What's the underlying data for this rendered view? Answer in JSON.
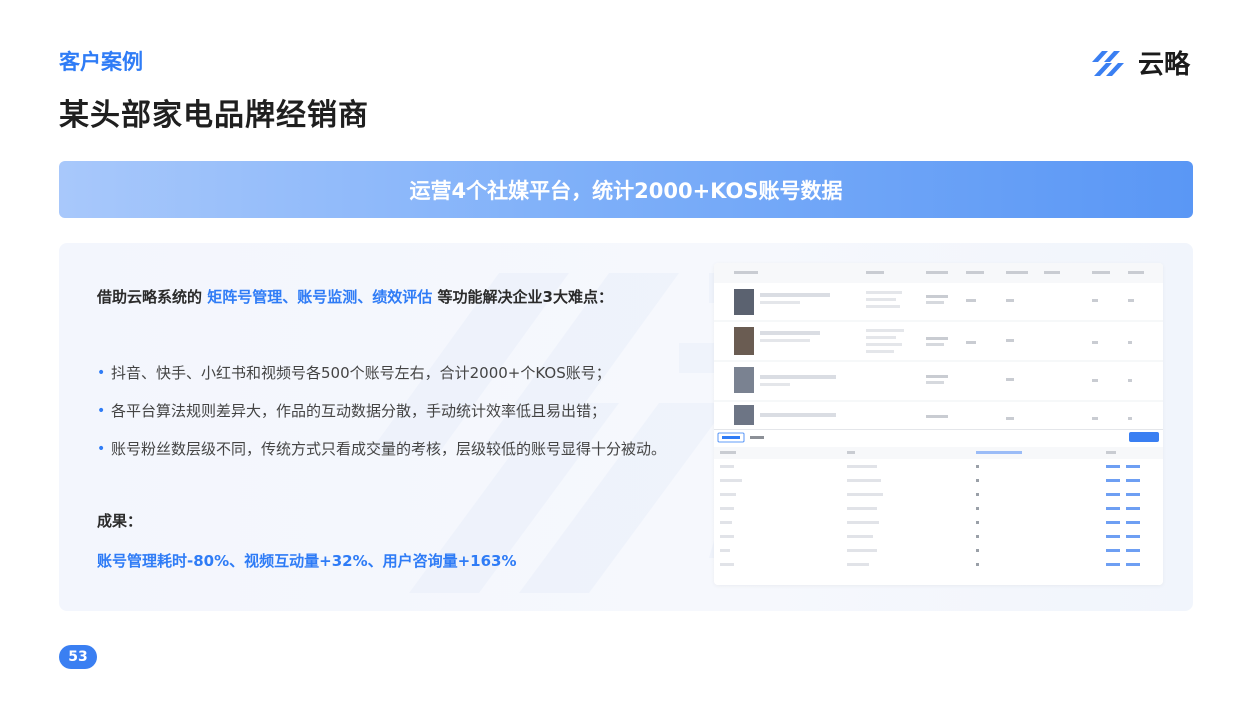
{
  "header": {
    "section_label": "客户案例",
    "title": "某头部家电品牌经销商"
  },
  "logo": {
    "text": "云略",
    "icon": "yunlue-logo-icon",
    "color": "#3a7ff2"
  },
  "banner": {
    "text": "运营4个社媒平台，统计2000+KOS账号数据"
  },
  "content": {
    "intro_prefix": "借助云略系统的",
    "intro_highlight": "矩阵号管理、账号监测、绩效评估",
    "intro_suffix": "等功能解决企业3大难点：",
    "bullets": [
      "抖音、快手、小红书和视频号各500个账号左右，合计2000+个KOS账号；",
      "各平台算法规则差异大，作品的互动数据分散，手动统计效率低且易出错；",
      "账号粉丝数层级不同，传统方式只看成交量的考核，层级较低的账号显得十分被动。"
    ],
    "result_label": "成果：",
    "result_value": "账号管理耗时-80%、视频互动量+32%、用户咨询量+163%"
  },
  "page_number": "53",
  "colors": {
    "accent": "#2f7cf6",
    "title": "#1f1f1f"
  }
}
